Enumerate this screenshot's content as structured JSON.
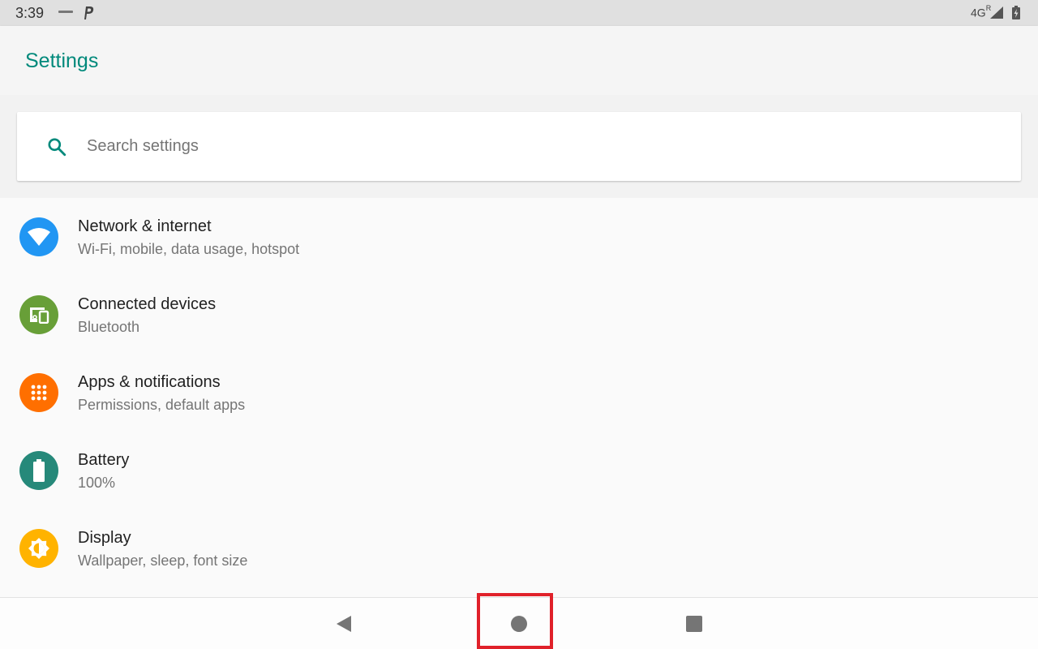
{
  "status_bar": {
    "time": "3:39",
    "network": "4G",
    "network_sup": "R",
    "icons": [
      "notification-mini-icon",
      "p-app-icon",
      "signal-icon",
      "battery-charging-icon"
    ]
  },
  "app_bar": {
    "title": "Settings"
  },
  "search": {
    "placeholder": "Search settings",
    "value": ""
  },
  "items": [
    {
      "title": "Network & internet",
      "subtitle": "Wi-Fi, mobile, data usage, hotspot",
      "icon": "wifi-icon",
      "color": "#2196f3"
    },
    {
      "title": "Connected devices",
      "subtitle": "Bluetooth",
      "icon": "devices-icon",
      "color": "#689f38"
    },
    {
      "title": "Apps & notifications",
      "subtitle": "Permissions, default apps",
      "icon": "apps-icon",
      "color": "#ff6f00"
    },
    {
      "title": "Battery",
      "subtitle": "100%",
      "icon": "battery-icon",
      "color": "#26897a"
    },
    {
      "title": "Display",
      "subtitle": "Wallpaper, sleep, font size",
      "icon": "brightness-icon",
      "color": "#ffb300"
    }
  ],
  "nav": {
    "buttons": [
      "back",
      "home",
      "recents"
    ],
    "highlighted": "home",
    "highlight_color": "#e0212a"
  },
  "colors": {
    "accent": "#00897b",
    "status_bar": "#e0e0e0",
    "app_bar": "#f5f5f5"
  }
}
